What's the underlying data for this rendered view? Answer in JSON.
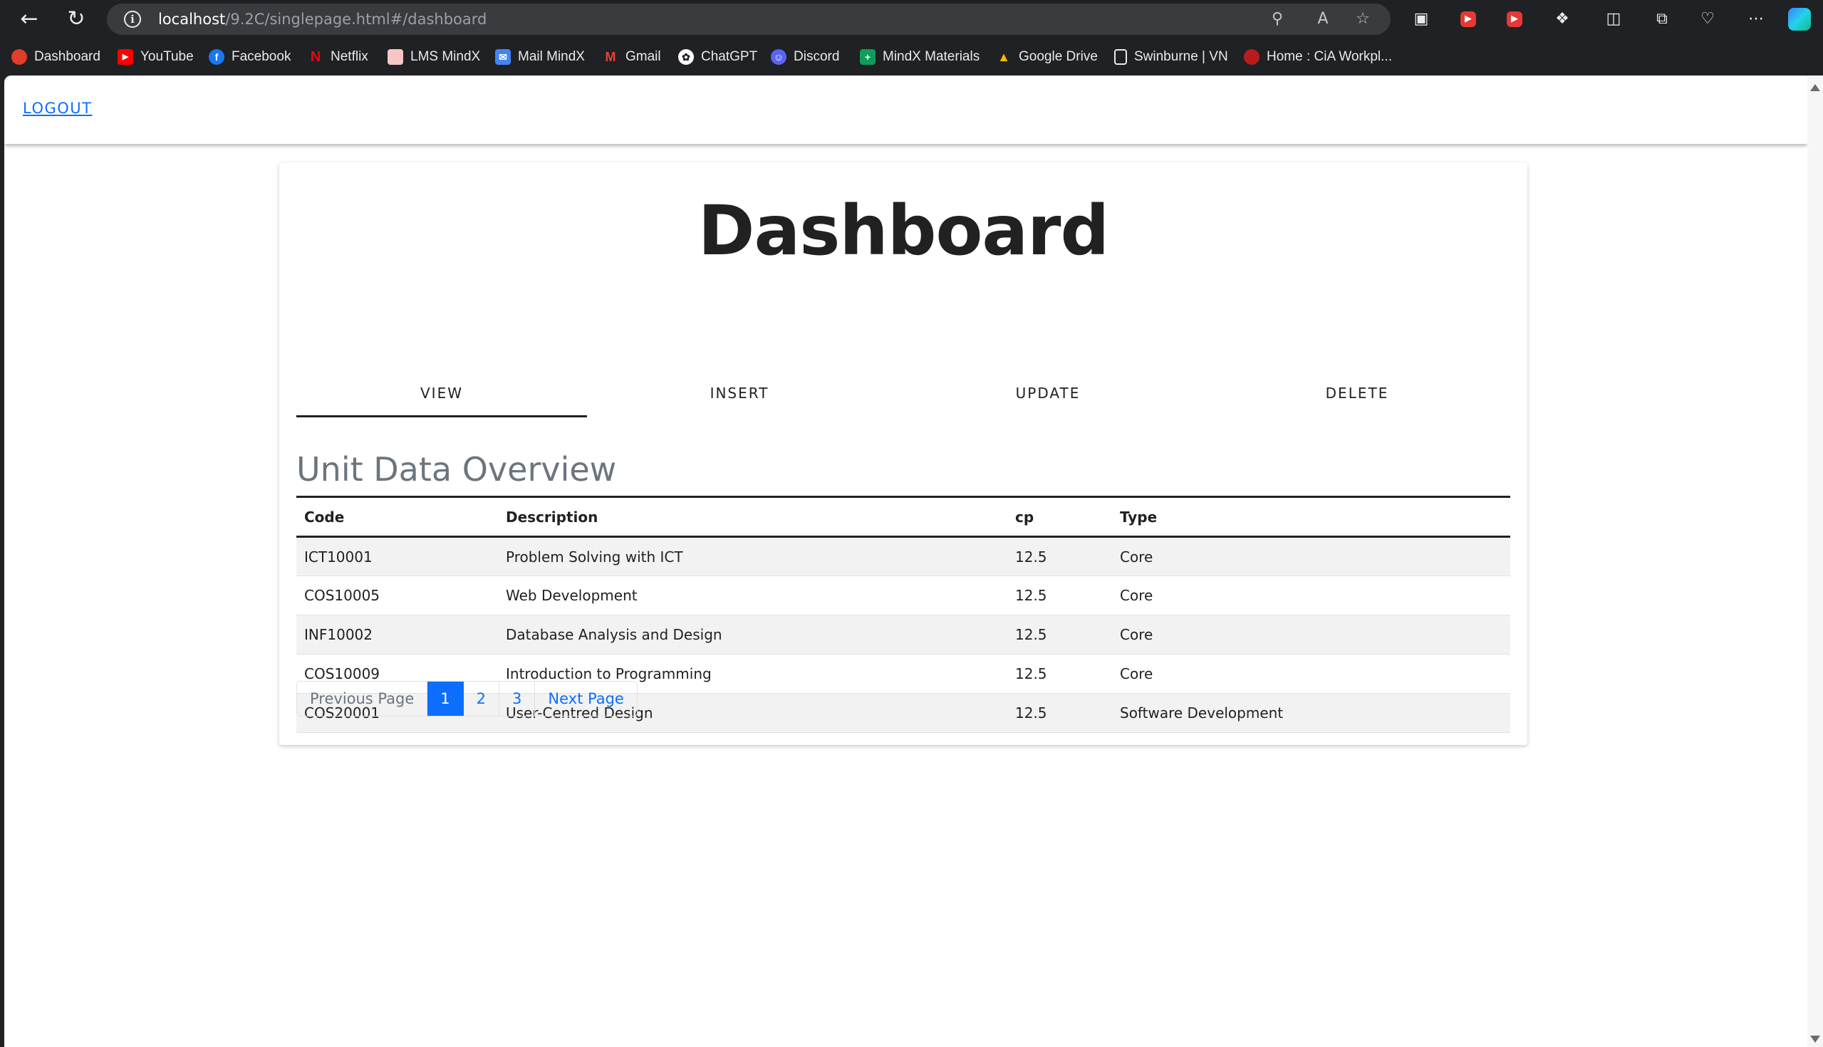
{
  "browser": {
    "url_host": "localhost",
    "url_path": "/9.2C/singlepage.html#/dashboard",
    "bookmarks": [
      {
        "label": "Dashboard",
        "icon": "canvas-icon",
        "color": "#e23d28"
      },
      {
        "label": "YouTube",
        "icon": "youtube-icon",
        "color": "#ff0000"
      },
      {
        "label": "Facebook",
        "icon": "facebook-icon",
        "color": "#1877f2"
      },
      {
        "label": "Netflix",
        "icon": "netflix-icon",
        "color": "#e50914"
      },
      {
        "label": "LMS MindX",
        "icon": "lms-icon",
        "color": "#f28b82"
      },
      {
        "label": "Mail MindX",
        "icon": "mail-icon",
        "color": "#4285f4"
      },
      {
        "label": "Gmail",
        "icon": "gmail-icon",
        "color": "#ea4335"
      },
      {
        "label": "ChatGPT",
        "icon": "chatgpt-icon",
        "color": "#ffffff"
      },
      {
        "label": "Discord",
        "icon": "discord-icon",
        "color": "#5865f2"
      },
      {
        "label": "MindX Materials",
        "icon": "sheets-icon",
        "color": "#0f9d58"
      },
      {
        "label": "Google Drive",
        "icon": "drive-icon",
        "color": "#fbbc04"
      },
      {
        "label": "Swinburne | VN",
        "icon": "page-icon",
        "color": "#e8eaed"
      },
      {
        "label": "Home : CiA Workpl...",
        "icon": "cia-icon",
        "color": "#b91c1c"
      }
    ]
  },
  "app": {
    "logout_label": "LOGOUT",
    "title": "Dashboard",
    "tabs": [
      {
        "label": "VIEW",
        "active": true
      },
      {
        "label": "INSERT",
        "active": false
      },
      {
        "label": "UPDATE",
        "active": false
      },
      {
        "label": "DELETE",
        "active": false
      }
    ],
    "section_title": "Unit Data Overview",
    "table": {
      "headers": [
        "Code",
        "Description",
        "cp",
        "Type"
      ],
      "rows": [
        [
          "ICT10001",
          "Problem Solving with ICT",
          "12.5",
          "Core"
        ],
        [
          "COS10005",
          "Web Development",
          "12.5",
          "Core"
        ],
        [
          "INF10002",
          "Database Analysis and Design",
          "12.5",
          "Core"
        ],
        [
          "COS10009",
          "Introduction to Programming",
          "12.5",
          "Core"
        ],
        [
          "COS20001",
          "User-Centred Design",
          "12.5",
          "Software Development"
        ]
      ]
    },
    "pagination": {
      "previous": "Previous Page",
      "pages": [
        "1",
        "2",
        "3"
      ],
      "current": "1",
      "next": "Next Page"
    }
  },
  "colors": {
    "accent": "#0d6efd",
    "muted": "#6c757d"
  }
}
